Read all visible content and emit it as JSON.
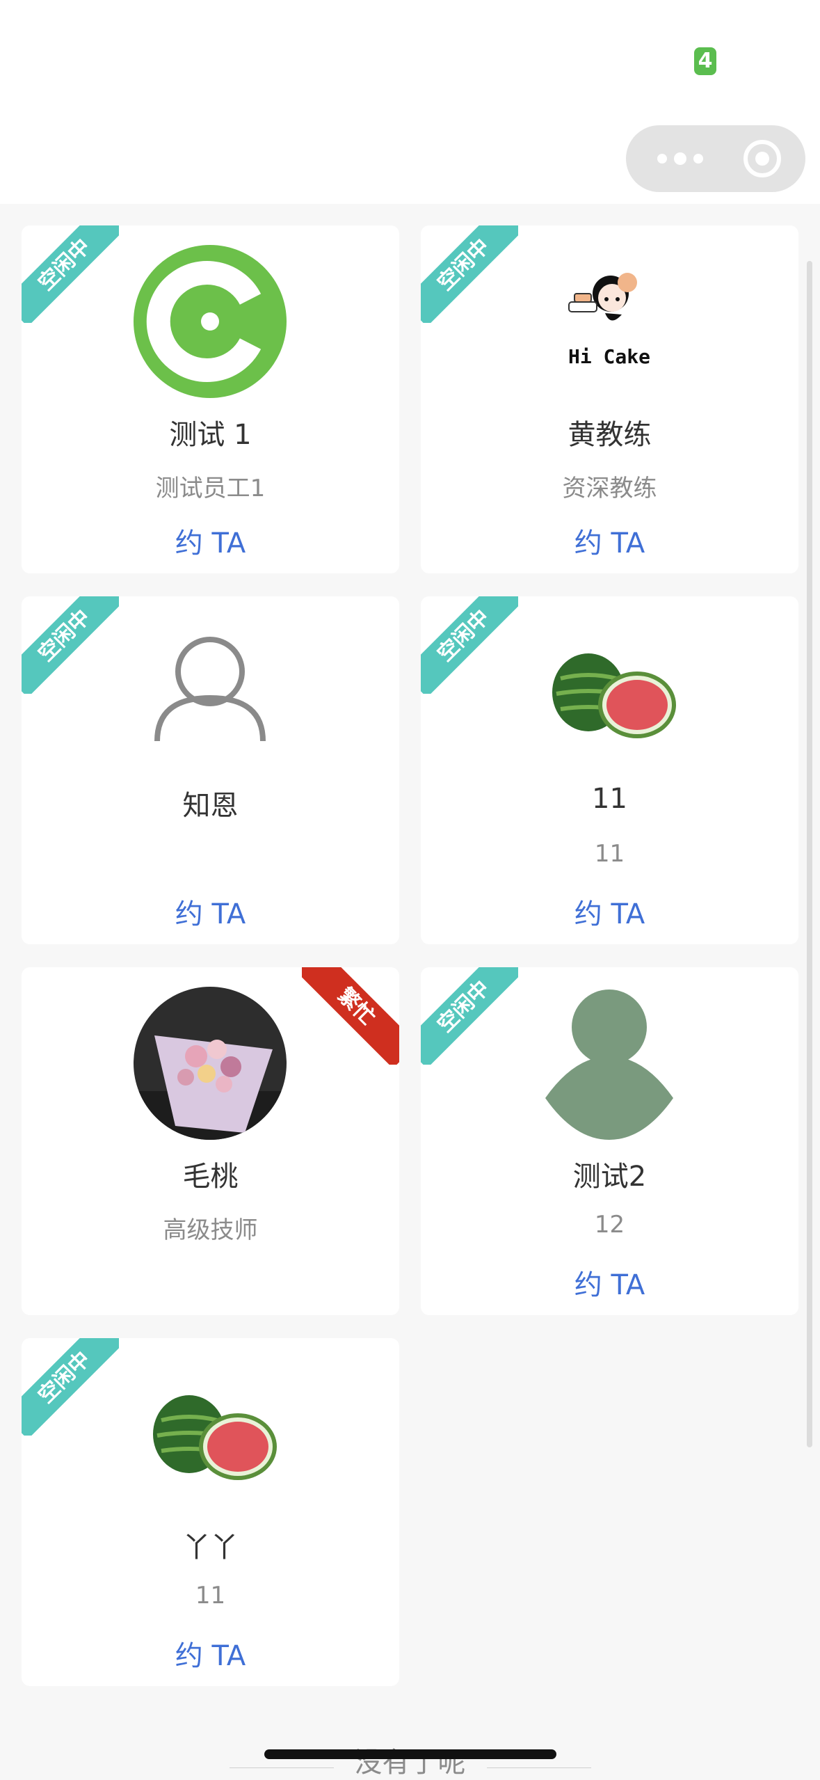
{
  "status_bar": {
    "badge": "4"
  },
  "cards": [
    {
      "status": "空闲中",
      "name": "测试 1",
      "role": "测试员工1",
      "action": "约 TA"
    },
    {
      "status": "空闲中",
      "name": "黄教练",
      "role": "资深教练",
      "action": "约 TA",
      "avatar_text": "Hi  Cake"
    },
    {
      "status": "空闲中",
      "name": "知恩",
      "role": "",
      "action": "约 TA"
    },
    {
      "status": "空闲中",
      "name": "11",
      "role": "11",
      "action": "约 TA"
    },
    {
      "status": "繁忙",
      "name": "毛桃",
      "role": "高级技师",
      "action": ""
    },
    {
      "status": "空闲中",
      "name": "测试2",
      "role": "12",
      "action": "约 TA"
    },
    {
      "status": "空闲中",
      "name": "丫丫",
      "role": "11",
      "action": "约 TA"
    }
  ],
  "footer": {
    "end_text": "没有了呢"
  },
  "colors": {
    "idle_ribbon": "#55c7bd",
    "busy_ribbon": "#cf2f1f",
    "action": "#3f6fd6"
  }
}
